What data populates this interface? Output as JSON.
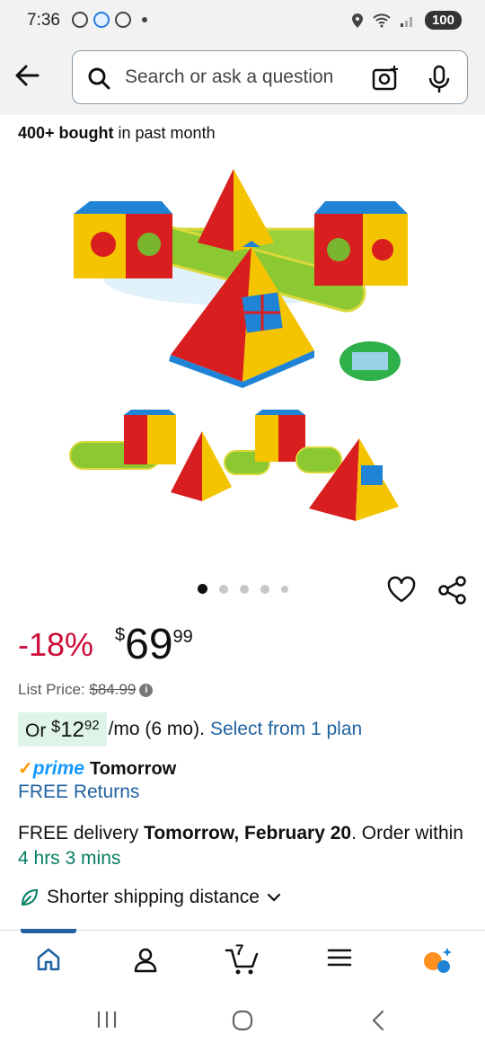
{
  "status_bar": {
    "time": "7:36",
    "battery": "100"
  },
  "search": {
    "placeholder": "Search or ask a question"
  },
  "social_proof": {
    "bold": "400+ bought",
    "rest": " in past month"
  },
  "pricing": {
    "discount": "-18%",
    "currency": "$",
    "price_whole": "69",
    "price_fraction": "99",
    "list_price_label": "List Price: ",
    "list_price_value": "$84.99"
  },
  "monthly": {
    "prefix": "Or ",
    "currency": "$",
    "amount_whole": "12",
    "amount_fraction": "92",
    "suffix": "/mo (6 mo).",
    "plan_link": "Select from 1 plan"
  },
  "prime": {
    "check": "✓",
    "word": "prime",
    "day": "Tomorrow",
    "returns": "FREE Returns"
  },
  "delivery": {
    "prefix": "FREE delivery ",
    "date": "Tomorrow, February 20",
    "middle": ". Order within ",
    "countdown": "4 hrs 3 mins"
  },
  "shipping": {
    "label": "Shorter shipping distance"
  },
  "bottom_nav": {
    "cart_count": "7"
  },
  "image_carousel": {
    "total": 5,
    "active": 1
  },
  "colors": {
    "discount": "#cc0c39",
    "link": "#2162a1",
    "prime": "#1399ff",
    "countdown": "#067d62",
    "pill_bg": "#dff4e8"
  },
  "icons": [
    "back-arrow-icon",
    "search-icon",
    "camera-icon",
    "mic-icon",
    "heart-icon",
    "share-icon",
    "info-icon",
    "leaf-icon",
    "chevron-down-icon",
    "home-icon",
    "account-icon",
    "cart-icon",
    "menu-icon",
    "rufus-icon"
  ]
}
